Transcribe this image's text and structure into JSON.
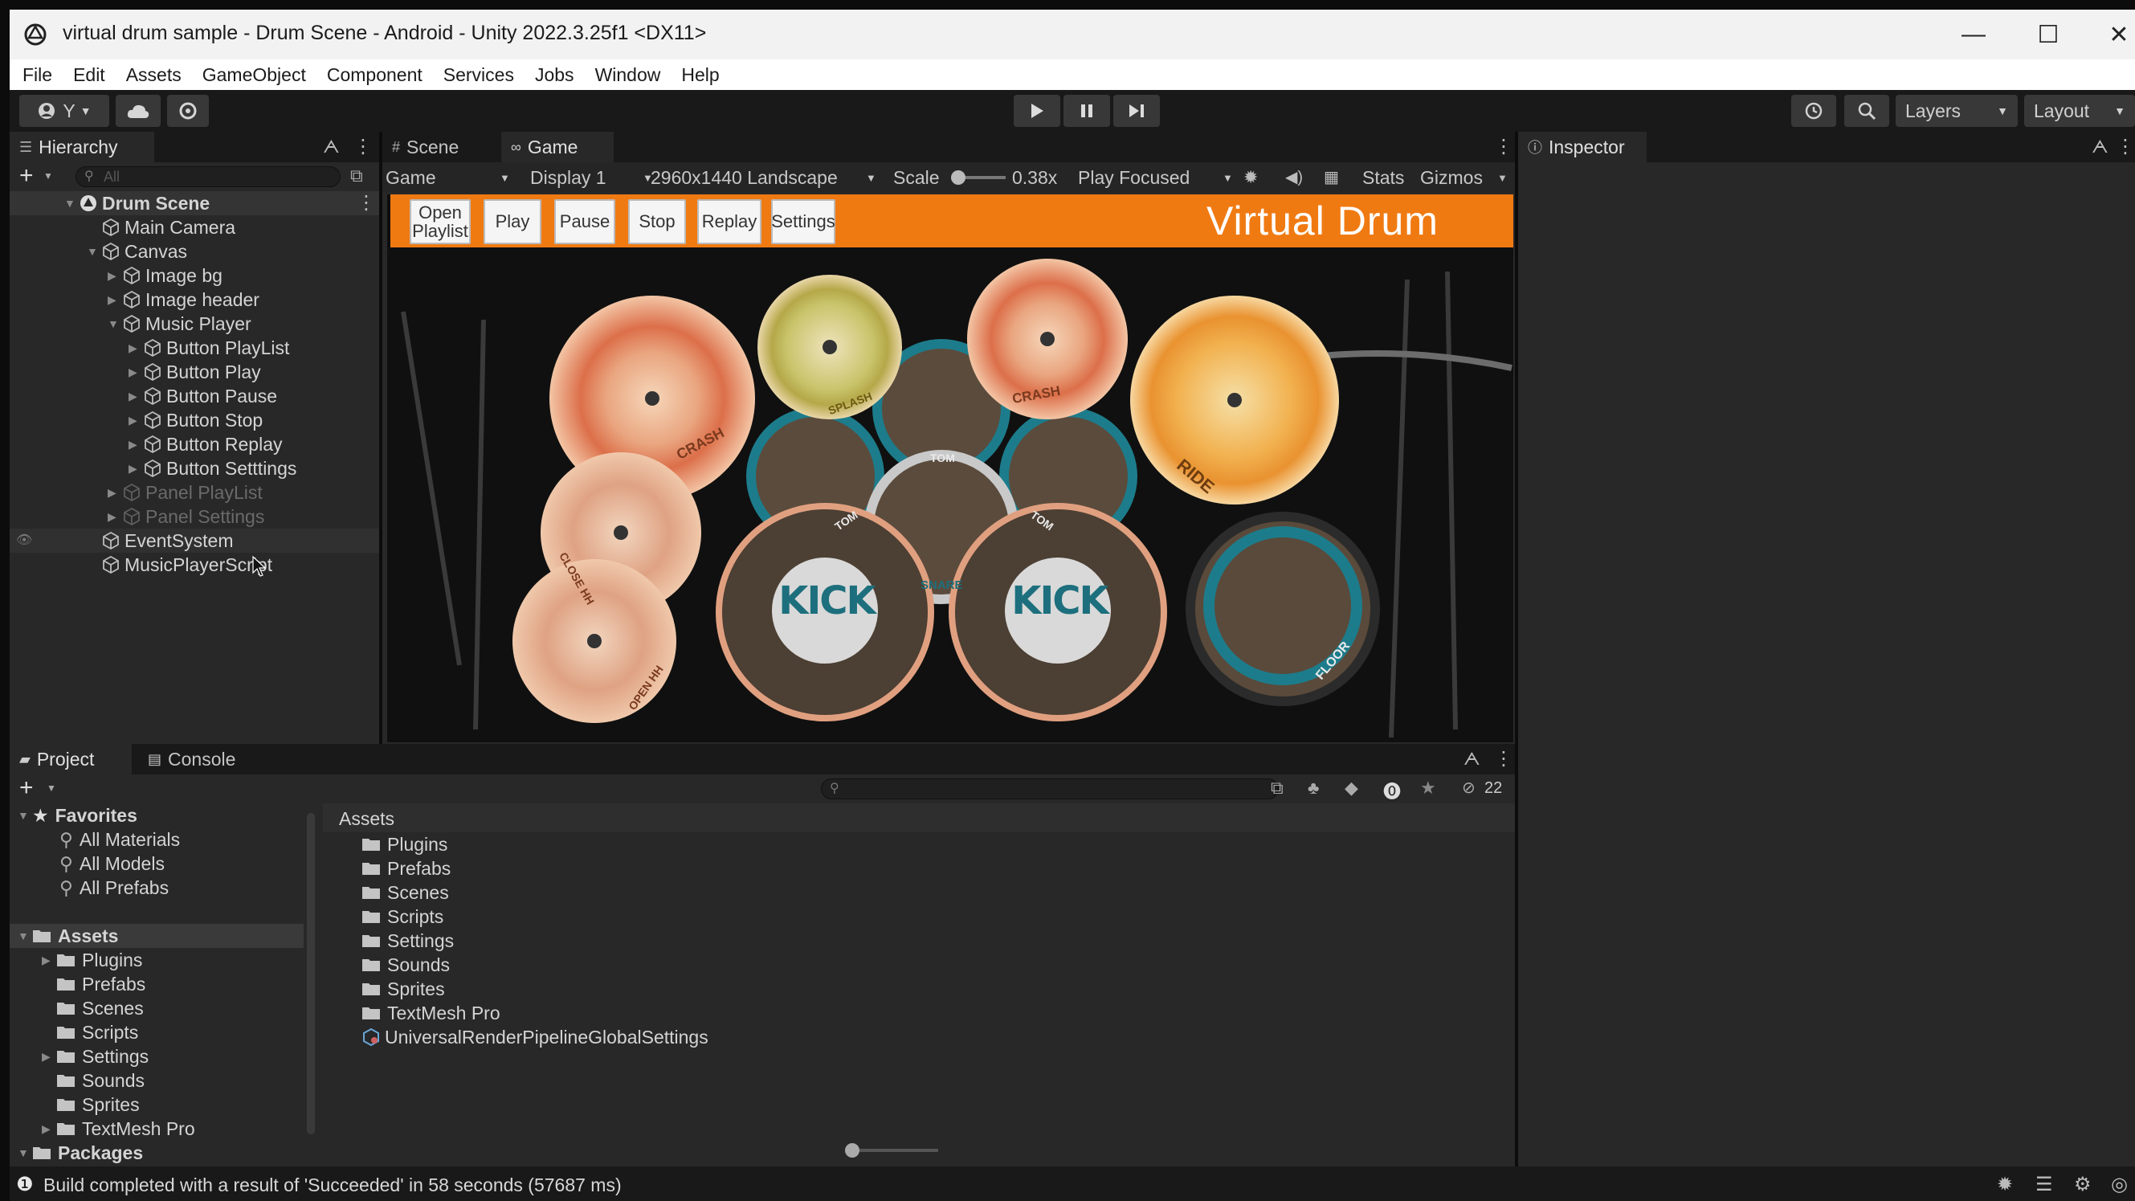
{
  "window": {
    "title": "virtual drum sample - Drum Scene - Android - Unity 2022.3.25f1 <DX11>",
    "minimize": "—",
    "maximize": "☐",
    "close": "✕"
  },
  "menu": [
    "File",
    "Edit",
    "Assets",
    "GameObject",
    "Component",
    "Services",
    "Jobs",
    "Window",
    "Help"
  ],
  "toolbar": {
    "account_label": "Y",
    "layers_label": "Layers",
    "layout_label": "Layout"
  },
  "hierarchy": {
    "tab": "Hierarchy",
    "search_placeholder": "All",
    "scene": "Drum Scene",
    "items": [
      {
        "label": "Main Camera"
      },
      {
        "label": "Canvas"
      },
      {
        "label": "Image bg"
      },
      {
        "label": "Image header"
      },
      {
        "label": "Music Player"
      },
      {
        "label": "Button PlayList"
      },
      {
        "label": "Button Play"
      },
      {
        "label": "Button Pause"
      },
      {
        "label": "Button Stop"
      },
      {
        "label": "Button Replay"
      },
      {
        "label": "Button Setttings"
      },
      {
        "label": "Panel PlayList"
      },
      {
        "label": "Panel Settings"
      },
      {
        "label": "EventSystem"
      },
      {
        "label": "MusicPlayerScript"
      }
    ]
  },
  "scene_tabs": {
    "scene": "Scene",
    "game": "Game"
  },
  "game_toolbar": {
    "mode": "Game",
    "display": "Display 1",
    "resolution": "2960x1440 Landscape",
    "scale_label": "Scale",
    "scale_value": "0.38x",
    "play_mode": "Play Focused",
    "stats": "Stats",
    "gizmos": "Gizmos"
  },
  "game_view": {
    "header_title": "Virtual Drum",
    "header_color": "#f07a12",
    "buttons": {
      "open_playlist_1": "Open",
      "open_playlist_2": "Playlist",
      "play": "Play",
      "pause": "Pause",
      "stop": "Stop",
      "replay": "Replay",
      "settings": "Settings"
    },
    "drums": {
      "kick_left": "KICK",
      "kick_right": "KICK",
      "crash_left": "CRASH",
      "crash_right": "CRASH",
      "splash": "SPLASH",
      "ride": "RIDE",
      "close_hh": "CLOSE HH",
      "open_hh": "OPEN HH",
      "tom_top": "TOM",
      "tom_left": "TOM",
      "tom_right": "TOM",
      "snare": "SNARE",
      "floor": "FLOOR"
    }
  },
  "inspector": {
    "tab": "Inspector"
  },
  "project": {
    "tab_project": "Project",
    "tab_console": "Console",
    "hidden_count": "22",
    "favorites_label": "Favorites",
    "favorites": [
      "All Materials",
      "All Models",
      "All Prefabs"
    ],
    "assets_label": "Assets",
    "assets_tree": [
      "Plugins",
      "Prefabs",
      "Scenes",
      "Scripts",
      "Settings",
      "Sounds",
      "Sprites",
      "TextMesh Pro"
    ],
    "packages_label": "Packages",
    "breadcrumb": "Assets",
    "files": [
      "Plugins",
      "Prefabs",
      "Scenes",
      "Scripts",
      "Settings",
      "Sounds",
      "Sprites",
      "TextMesh Pro"
    ],
    "asset_file": "UniversalRenderPipelineGlobalSettings"
  },
  "status": {
    "message": "Build completed with a result of 'Succeeded' in 58 seconds (57687 ms)"
  },
  "colors": {
    "accent_blue": "#2c5d87",
    "tom_teal": "#1f7d8c"
  }
}
